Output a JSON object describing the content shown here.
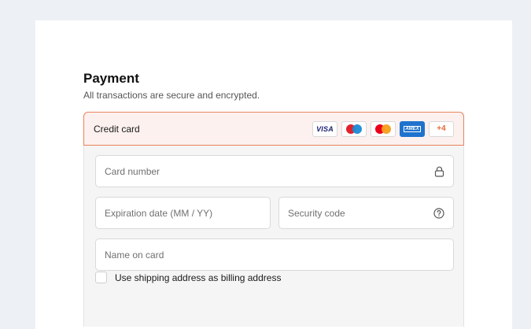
{
  "payment": {
    "title": "Payment",
    "subtitle": "All transactions are secure and encrypted."
  },
  "method": {
    "label": "Credit card",
    "brands": [
      "visa",
      "maestro",
      "mastercard",
      "amex"
    ],
    "visa_text": "VISA",
    "amex_text": "AMEX",
    "more_label": "+4"
  },
  "fields": {
    "card_number": {
      "placeholder": "Card number",
      "icon": "lock-icon"
    },
    "expiration": {
      "placeholder": "Expiration date (MM / YY)"
    },
    "security_code": {
      "placeholder": "Security code",
      "icon": "help-circle-icon"
    },
    "name_on_card": {
      "placeholder": "Name on card"
    }
  },
  "billing": {
    "checkbox_label": "Use shipping address as billing address",
    "checked": false
  },
  "colors": {
    "accent": "#e8835c",
    "header_bg": "#fcf1ef",
    "page_bg": "#edf1f5",
    "more_text": "#e86a3a"
  }
}
